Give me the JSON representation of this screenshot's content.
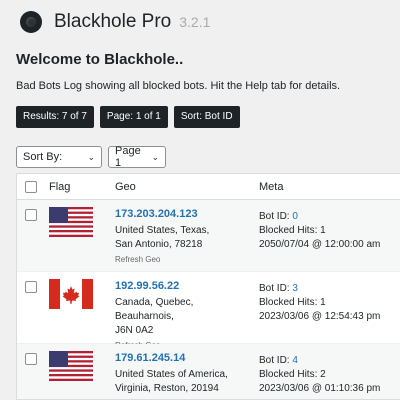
{
  "header": {
    "app_name": "Blackhole Pro",
    "version": "3.2.1"
  },
  "welcome": "Welcome to Blackhole..",
  "description": "Bad Bots Log showing all blocked bots. Hit the Help tab for details.",
  "badges": {
    "results": "Results: 7 of 7",
    "page": "Page: 1 of 1",
    "sort": "Sort: Bot ID"
  },
  "filters": {
    "sort_by": "Sort By:",
    "page": "Page 1"
  },
  "table": {
    "columns": {
      "flag": "Flag",
      "geo": "Geo",
      "meta": "Meta"
    },
    "refresh_label": "Refresh Geo",
    "rows": [
      {
        "flag": "us-flag",
        "ip": "173.203.204.123",
        "loc1": "United States, Texas,",
        "loc2": "San Antonio, 78218",
        "bot_id_label": "Bot ID:",
        "bot_id": "0",
        "hits": "Blocked Hits: 1",
        "date": "2050/07/04 @ 12:00:00 am"
      },
      {
        "flag": "canada-flag",
        "ip": "192.99.56.22",
        "loc1": "Canada, Quebec, Beauharnois,",
        "loc2": "J6N 0A2",
        "bot_id_label": "Bot ID:",
        "bot_id": "3",
        "hits": "Blocked Hits: 1",
        "date": "2023/03/06 @ 12:54:43 pm"
      },
      {
        "flag": "us-flag",
        "ip": "179.61.245.14",
        "loc1": "United States of America,",
        "loc2": "Virginia, Reston, 20194",
        "bot_id_label": "Bot ID:",
        "bot_id": "4",
        "hits": "Blocked Hits: 2",
        "date": "2023/03/06 @ 01:10:36 pm"
      }
    ]
  },
  "colors": {
    "badge_bg": "#1d2327",
    "link": "#2271b1",
    "flag_red": "#d52b1e",
    "us_blue": "#3c3b6e",
    "us_red": "#b22234"
  }
}
